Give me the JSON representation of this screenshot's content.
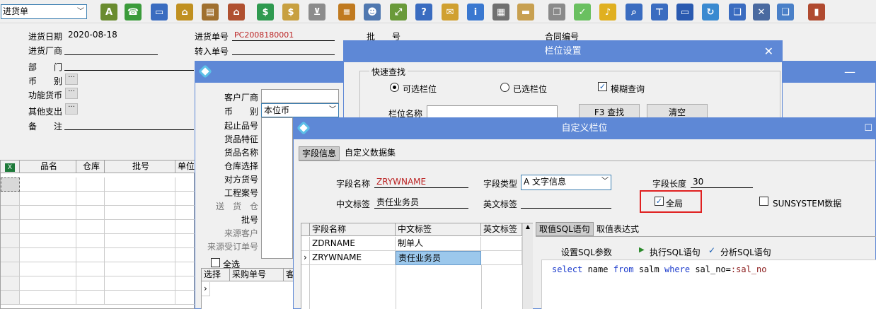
{
  "toolbar": {
    "doc_type": "进货单",
    "icons": [
      "spell-check-icon",
      "phone-icon",
      "computer-icon",
      "lock-icon",
      "briefcase-icon",
      "home-icon",
      "dollar-icon",
      "money-bag-icon",
      "cart-icon",
      "clipboard-icon",
      "users-icon",
      "link-icon",
      "help-doc-icon",
      "mail-icon",
      "info-icon",
      "calculator-icon",
      "folder-icon",
      "copy-icon",
      "check-icon",
      "bell-icon",
      "search-icon",
      "org-chart-icon",
      "monitor-icon",
      "refresh-icon",
      "window-icon",
      "close-icon",
      "window-alt-icon",
      "exit-door-icon"
    ],
    "icon_colors": [
      "#6a8c2f",
      "#3b9b3b",
      "#3a6cc0",
      "#c09020",
      "#a0702f",
      "#b05030",
      "#2f9a50",
      "#c8a040",
      "#8c8c8c",
      "#c07a20",
      "#5078b0",
      "#6a9a3a",
      "#3a6cc0",
      "#d0a030",
      "#3a78d0",
      "#707070",
      "#c8a050",
      "#8a8a8a",
      "#6ac060",
      "#e0b020",
      "#3a6cc0",
      "#3a6cc0",
      "#2a5ab0",
      "#3a8ad0",
      "#3a6cc0",
      "#4a6aa0",
      "#4a80c8",
      "#b04a30"
    ]
  },
  "form": {
    "date_label": "进货日期",
    "date_value": "2020-08-18",
    "supplier_label": "进货厂商",
    "dept_label": "部　　门",
    "currency_label": "币　　别",
    "func_currency_label": "功能货币",
    "other_expense_label": "其他支出",
    "remark_label": "备　　注",
    "order_no_label": "进货单号",
    "order_no_value": "PC2008180001",
    "transfer_no_label": "转入单号",
    "batch_label": "批　　号",
    "contract_label": "合同编号"
  },
  "main_grid": {
    "headers": [
      "品名",
      "仓库",
      "批号",
      "单位"
    ]
  },
  "filter_window": {
    "labels": [
      "客户厂商",
      "币　　别",
      "起止品号",
      "货品特征",
      "货品名称",
      "仓库选择",
      "对方货号",
      "工程案号",
      "送　货　仓",
      "批号",
      "来源客户",
      "来源受订单号"
    ],
    "currency_value": "本位币",
    "select_all": "全选",
    "headers": [
      "选择",
      "采购单号",
      "客"
    ]
  },
  "col_window": {
    "title": "栏位设置",
    "quick_search": "快速查找",
    "radio_available": "可选栏位",
    "radio_selected": "已选栏位",
    "fuzzy_query": "模糊查询",
    "field_name_label": "栏位名称",
    "f3_find": "F3 查找",
    "clear": "清空"
  },
  "custom_window": {
    "title": "自定义栏位",
    "tabs": [
      "字段信息",
      "自定义数据集"
    ],
    "field_name_label": "字段名称",
    "field_name_value": "ZRYWNAME",
    "field_type_label": "字段类型",
    "field_type_value": "A 文字信息",
    "field_length_label": "字段长度",
    "field_length_value": "30",
    "cn_label_label": "中文标签",
    "cn_label_value": "责任业务员",
    "en_label_label": "英文标签",
    "global_label": "全局",
    "sunsystem_label": "SUNSYSTEM数据",
    "grid_headers": [
      "字段名称",
      "中文标签",
      "英文标签"
    ],
    "grid_rows": [
      [
        "ZDRNAME",
        "制单人",
        ""
      ],
      [
        "ZRYWNAME",
        "责任业务员",
        ""
      ]
    ],
    "sql_tabs": [
      "取值SQL语句",
      "取值表达式"
    ],
    "set_params": "设置SQL参数",
    "exec_sql": "执行SQL语句",
    "parse_sql": "分析SQL语句",
    "sql_keyword1": "select",
    "sql_text1": " name ",
    "sql_keyword2": "from",
    "sql_text2": " salm ",
    "sql_keyword3": "where",
    "sql_text3": " sal_no=",
    "sql_param": ":sal_no"
  }
}
